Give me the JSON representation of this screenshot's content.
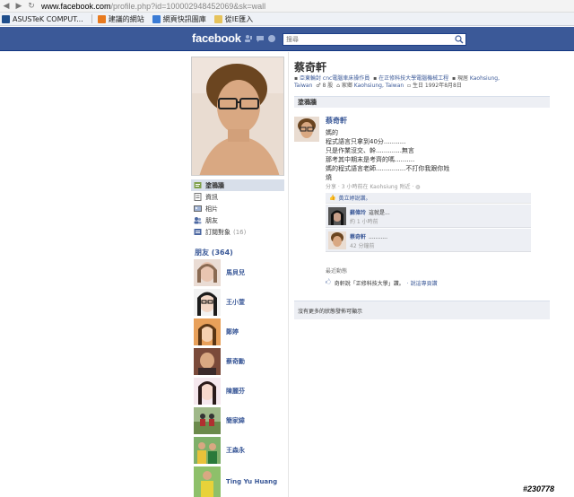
{
  "browser": {
    "url_host": "www.facebook.com",
    "url_rest": "/profile.php?id=100002948452069&sk=wall",
    "bookmarks": [
      {
        "label": "ASUSTeK COMPUT...",
        "icon": "asus-icon",
        "color": "#1f4e8c"
      },
      {
        "label": "建議的網站",
        "icon": "suggested-sites-icon",
        "color": "#e87a1e"
      },
      {
        "label": "網頁快訊圖庫",
        "icon": "web-slice-icon",
        "color": "#3a7bd5"
      },
      {
        "label": "從IE匯入",
        "icon": "folder-icon",
        "color": "#e6c35c"
      }
    ]
  },
  "header": {
    "logo": "facebook",
    "search_placeholder": "搜尋"
  },
  "sidebar": {
    "nav": [
      {
        "label": "塗鴉牆",
        "icon": "wall-icon",
        "active": true
      },
      {
        "label": "資訊",
        "icon": "info-icon"
      },
      {
        "label": "相片",
        "icon": "photos-icon"
      },
      {
        "label": "朋友",
        "icon": "friends-icon"
      },
      {
        "label": "訂閱對象",
        "icon": "subscriptions-icon",
        "count": "(16)"
      }
    ],
    "friends_title": "朋友 (364)",
    "friends": [
      {
        "name": "馬貝兒"
      },
      {
        "name": "王小萱"
      },
      {
        "name": "鄭婷"
      },
      {
        "name": "蔡奇勳"
      },
      {
        "name": "陳麗芬"
      },
      {
        "name": "簡家緯"
      },
      {
        "name": "王森永"
      },
      {
        "name": "Ting Yu Huang"
      }
    ]
  },
  "profile": {
    "name": "蔡奇軒",
    "info_1_a": "亞東輪封 cnc電腦車床操作員",
    "info_1_b": "在正修科技大學電腦機械工程",
    "info_1_c": "現居",
    "info_1_c_link": "Kaohsiung,",
    "info_2_a": "Taiwan",
    "info_2_b": "8 股",
    "info_2_c": "家鄉",
    "info_2_c_link": "Kaohsiung, Taiwan",
    "info_2_d": "生日 1992年8月8日"
  },
  "wall": {
    "tab_label": "塗鴉牆",
    "post": {
      "author": "蔡奇軒",
      "lines": [
        "媽的",
        "程式語言只拿到40分...........",
        "只是作業沒交、幹.............無言",
        "那考其中期末是考齊的嗎..........",
        "媽的程式語言老師...............不打你我跟你姓",
        "燒"
      ],
      "meta": "分享 · 3 小時前在 Kaohsiung 附近 · ",
      "likes": "黃立婷說讚。",
      "comments": [
        {
          "name": "蘇偉玲",
          "text": "這就是...",
          "time": "約 1 小時前"
        },
        {
          "name": "蔡奇軒",
          "text": "...........",
          "time": "42 分鐘前"
        }
      ]
    },
    "recent_title": "最近動態",
    "recent_text": "奇軒說「正修科技大學」讚。",
    "recent_link": "· 說這專頁讚",
    "no_more": "沒有更多的狀態發佈可顯示"
  },
  "watermark": "#230778"
}
